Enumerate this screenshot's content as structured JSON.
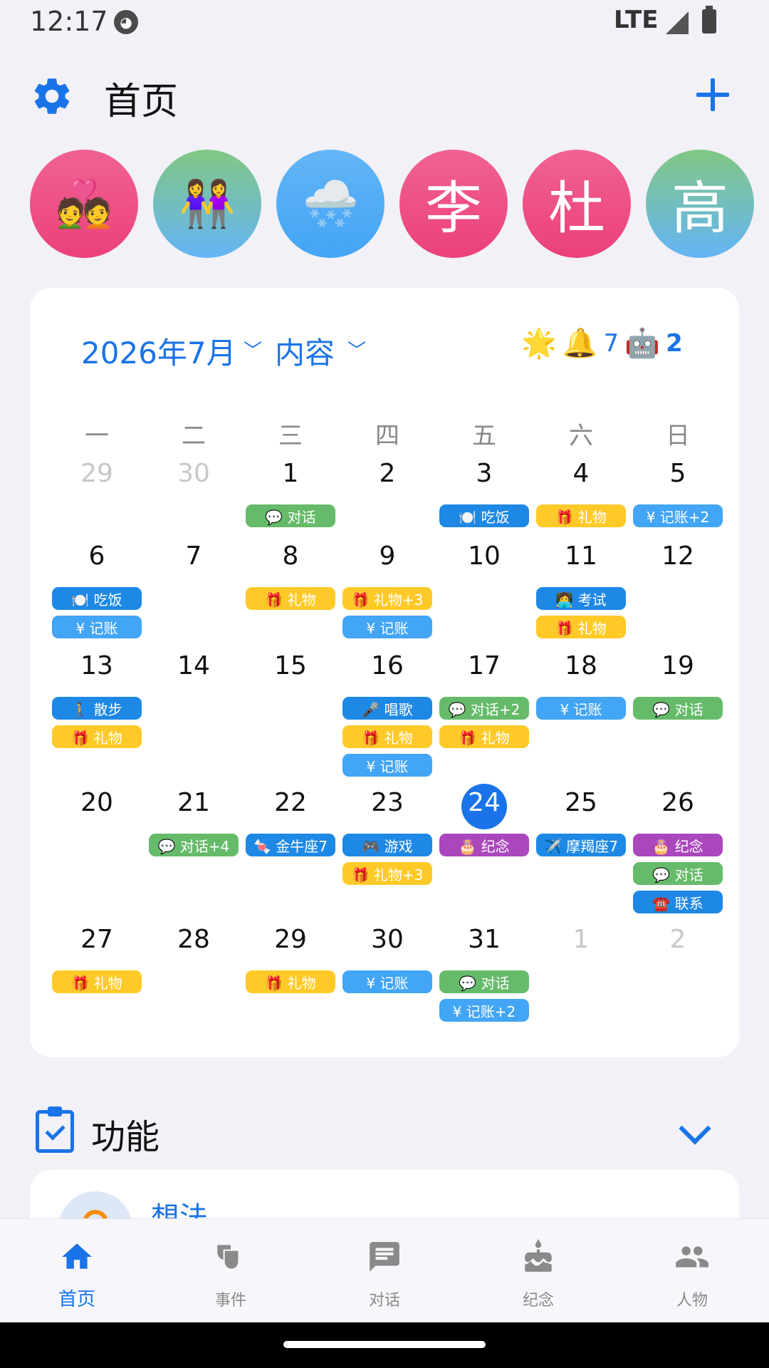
{
  "status_bar": {
    "time": "12:17",
    "network": "LTE"
  },
  "header": {
    "title": "首页"
  },
  "avatars": [
    {
      "type": "emoji",
      "content": "💑",
      "color": "pink"
    },
    {
      "type": "emoji",
      "content": "👭",
      "color": "green-blue"
    },
    {
      "type": "emoji",
      "content": "🌨️",
      "color": "blue"
    },
    {
      "type": "text",
      "content": "李",
      "color": "pink"
    },
    {
      "type": "text",
      "content": "杜",
      "color": "pink"
    },
    {
      "type": "text",
      "content": "高",
      "color": "green-blue"
    }
  ],
  "calendar": {
    "month_label": "2026年7月",
    "content_label": "内容",
    "status_icons": {
      "star": "🌟",
      "bell": "🔔",
      "bell_count": "7",
      "robot": "🤖",
      "robot_count": "2"
    },
    "weekdays": [
      "一",
      "二",
      "三",
      "四",
      "五",
      "六",
      "日"
    ],
    "today": "24",
    "weeks": [
      [
        {
          "day": "29",
          "muted": true,
          "events": []
        },
        {
          "day": "30",
          "muted": true,
          "events": []
        },
        {
          "day": "1",
          "events": [
            {
              "label": "💬 对话",
              "color": "green"
            }
          ]
        },
        {
          "day": "2",
          "events": []
        },
        {
          "day": "3",
          "events": [
            {
              "label": "🍽️ 吃饭",
              "color": "darkblue"
            }
          ]
        },
        {
          "day": "4",
          "events": [
            {
              "label": "🎁 礼物",
              "color": "yellow"
            }
          ]
        },
        {
          "day": "5",
          "events": [
            {
              "label": "¥ 记账+2",
              "color": "blue"
            }
          ]
        }
      ],
      [
        {
          "day": "6",
          "events": [
            {
              "label": "🍽️ 吃饭",
              "color": "darkblue"
            },
            {
              "label": "¥ 记账",
              "color": "blue"
            }
          ]
        },
        {
          "day": "7",
          "events": []
        },
        {
          "day": "8",
          "events": [
            {
              "label": "🎁 礼物",
              "color": "yellow"
            }
          ]
        },
        {
          "day": "9",
          "events": [
            {
              "label": "🎁 礼物+3",
              "color": "yellow"
            },
            {
              "label": "¥ 记账",
              "color": "blue"
            }
          ]
        },
        {
          "day": "10",
          "events": []
        },
        {
          "day": "11",
          "events": [
            {
              "label": "👩‍💻 考试",
              "color": "darkblue"
            },
            {
              "label": "🎁 礼物",
              "color": "yellow"
            }
          ]
        },
        {
          "day": "12",
          "events": []
        }
      ],
      [
        {
          "day": "13",
          "events": [
            {
              "label": "🚶 散步",
              "color": "darkblue"
            },
            {
              "label": "🎁 礼物",
              "color": "yellow"
            }
          ]
        },
        {
          "day": "14",
          "events": []
        },
        {
          "day": "15",
          "events": []
        },
        {
          "day": "16",
          "events": [
            {
              "label": "🎤 唱歌",
              "color": "darkblue"
            },
            {
              "label": "🎁 礼物",
              "color": "yellow"
            },
            {
              "label": "¥ 记账",
              "color": "blue"
            }
          ]
        },
        {
          "day": "17",
          "events": [
            {
              "label": "💬 对话+2",
              "color": "green"
            },
            {
              "label": "🎁 礼物",
              "color": "yellow"
            }
          ]
        },
        {
          "day": "18",
          "events": [
            {
              "label": "¥ 记账",
              "color": "blue"
            }
          ]
        },
        {
          "day": "19",
          "events": [
            {
              "label": "💬 对话",
              "color": "green"
            }
          ]
        }
      ],
      [
        {
          "day": "20",
          "events": []
        },
        {
          "day": "21",
          "events": [
            {
              "label": "💬 对话+4",
              "color": "green"
            }
          ]
        },
        {
          "day": "22",
          "events": [
            {
              "label": "🍬 金牛座7",
              "color": "darkblue"
            }
          ]
        },
        {
          "day": "23",
          "events": [
            {
              "label": "🎮 游戏",
              "color": "darkblue"
            },
            {
              "label": "🎁 礼物+3",
              "color": "yellow"
            }
          ]
        },
        {
          "day": "24",
          "today": true,
          "events": [
            {
              "label": "🎂 纪念",
              "color": "purple"
            }
          ]
        },
        {
          "day": "25",
          "events": [
            {
              "label": "✈️ 摩羯座7",
              "color": "darkblue"
            }
          ]
        },
        {
          "day": "26",
          "events": [
            {
              "label": "🎂 纪念",
              "color": "purple"
            },
            {
              "label": "💬 对话",
              "color": "green"
            },
            {
              "label": "☎️ 联系",
              "color": "darkblue"
            }
          ]
        }
      ],
      [
        {
          "day": "27",
          "events": [
            {
              "label": "🎁 礼物",
              "color": "yellow"
            }
          ]
        },
        {
          "day": "28",
          "events": []
        },
        {
          "day": "29",
          "events": [
            {
              "label": "🎁 礼物",
              "color": "yellow"
            }
          ]
        },
        {
          "day": "30",
          "events": [
            {
              "label": "¥ 记账",
              "color": "blue"
            }
          ]
        },
        {
          "day": "31",
          "events": [
            {
              "label": "💬 对话",
              "color": "green"
            },
            {
              "label": "¥ 记账+2",
              "color": "blue"
            }
          ]
        },
        {
          "day": "1",
          "muted": true,
          "events": []
        },
        {
          "day": "2",
          "muted": true,
          "events": []
        }
      ]
    ]
  },
  "functions": {
    "title": "功能",
    "first_item": "想法"
  },
  "bottom_nav": [
    {
      "label": "首页",
      "icon": "home-icon",
      "active": true
    },
    {
      "label": "事件",
      "icon": "masks-icon",
      "active": false
    },
    {
      "label": "对话",
      "icon": "chat-icon",
      "active": false
    },
    {
      "label": "纪念",
      "icon": "cake-icon",
      "active": false
    },
    {
      "label": "人物",
      "icon": "people-icon",
      "active": false
    }
  ],
  "colors": {
    "accent": "#1A73E8",
    "background": "#F1F1F7",
    "chip_green": "#66BB6A",
    "chip_blue": "#42A5F5",
    "chip_darkblue": "#1E88E5",
    "chip_yellow": "#FFCA28",
    "chip_purple": "#AB47BC"
  }
}
